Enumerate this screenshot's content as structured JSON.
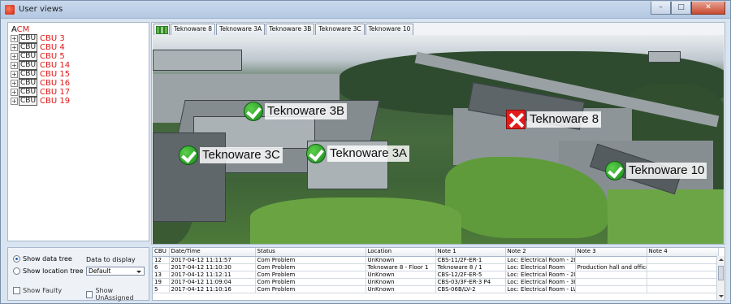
{
  "window": {
    "title": "User views",
    "controls": [
      "–",
      "□",
      "✕"
    ]
  },
  "tree": {
    "root_prefix": "A",
    "root_accent": "CM",
    "items": [
      {
        "tag": "CBU",
        "label": "CBU 3"
      },
      {
        "tag": "CBU",
        "label": "CBU 4"
      },
      {
        "tag": "CBU",
        "label": "CBU 5"
      },
      {
        "tag": "CBU",
        "label": "CBU 14"
      },
      {
        "tag": "CBU",
        "label": "CBU 15"
      },
      {
        "tag": "CBU",
        "label": "CBU 16"
      },
      {
        "tag": "CBU",
        "label": "CBU 17"
      },
      {
        "tag": "CBU",
        "label": "CBU 19"
      }
    ],
    "expand_glyph": "+"
  },
  "tabs": [
    "Teknoware 8",
    "Teknoware 3A",
    "Teknoware 3B",
    "Teknoware 3C",
    "Teknoware 10"
  ],
  "markers": [
    {
      "label": "Teknoware 3B",
      "status": "ok"
    },
    {
      "label": "Teknoware 8",
      "status": "fault"
    },
    {
      "label": "Teknoware 3C",
      "status": "ok"
    },
    {
      "label": "Teknoware 3A",
      "status": "ok"
    },
    {
      "label": "Teknoware 10",
      "status": "ok"
    }
  ],
  "options": {
    "show_data_tree": "Show data tree",
    "show_location_tree": "Show location tree",
    "data_to_display": "Data to display",
    "select_value": "Default",
    "show_faulty": "Show Faulty",
    "show_unassigned": "Show UnAssigned"
  },
  "table": {
    "columns": [
      "CBU",
      "Date/Time",
      "Status",
      "Location",
      "Note 1",
      "Note 2",
      "Note 3",
      "Note 4"
    ],
    "rows": [
      [
        "12",
        "2017-04-12 11:11:57",
        "Com Problem",
        "UnKnown",
        "CBS-11/2F-ER-1",
        "Loc: Electrical Room - 2F-ER...",
        "",
        ""
      ],
      [
        "6",
        "2017-04-12 11:10:30",
        "Com Problem",
        "Teknoware 8 - Floor 1",
        "Teknoware 8 / 1",
        "Loc: Electrical Room",
        "Production hall and office",
        ""
      ],
      [
        "13",
        "2017-04-12 11:12:11",
        "Com Problem",
        "UnKnown",
        "CBS-12/2F-ER-5",
        "Loc: Electrical Room - 2F-ER...",
        "",
        ""
      ],
      [
        "19",
        "2017-04-12 11:09:04",
        "Com Problem",
        "UnKnown",
        "CBS-03/3F-ER-3 P4",
        "Loc: Electrical Room - 3F-ER...",
        "",
        ""
      ],
      [
        "5",
        "2017-04-12 11:10:16",
        "Com Problem",
        "UnKnown",
        "CBS-06B/LV-2",
        "Loc: Electrical Room - LV-2 -...",
        "",
        ""
      ]
    ]
  }
}
